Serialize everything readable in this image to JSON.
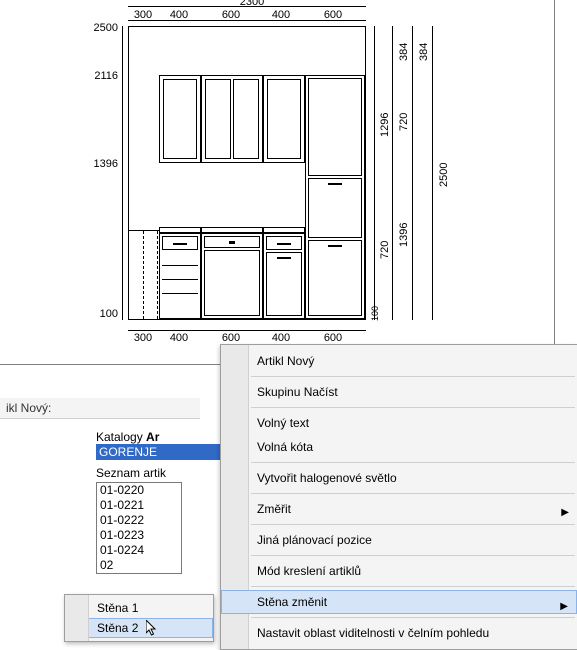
{
  "panel": {
    "title": "ikl Nový:"
  },
  "katalog": {
    "label_prefix": "Katalogy",
    "label_bold": "Ar",
    "selected": "GORENJE",
    "list_label": "Seznam artik",
    "items": [
      "01-0220",
      "01-0221",
      "01-0222",
      "01-0223",
      "01-0224",
      "02"
    ]
  },
  "context_menu": {
    "items": [
      {
        "label": "Artikl Nový",
        "sub": false
      },
      {
        "sep": true
      },
      {
        "label": "Skupinu Načíst",
        "sub": false
      },
      {
        "sep": true
      },
      {
        "label": "Volný text",
        "sub": false
      },
      {
        "label": "Volná kóta",
        "sub": false
      },
      {
        "sep": true
      },
      {
        "label": "Vytvořit halogenové světlo",
        "sub": false
      },
      {
        "sep": true
      },
      {
        "label": "Změřit",
        "sub": true
      },
      {
        "sep": true
      },
      {
        "label": "Jiná plánovací pozice",
        "sub": false
      },
      {
        "sep": true
      },
      {
        "label": "Mód kreslení artiklů",
        "sub": false
      },
      {
        "sep": true
      },
      {
        "label": "Stěna změnit",
        "sub": true,
        "highlight": true
      },
      {
        "sep": true
      },
      {
        "label": "Nastavit oblast viditelnosti v čelním pohledu",
        "sub": false
      }
    ]
  },
  "wall_submenu": {
    "items": [
      "Stěna 1",
      "Stěna 2"
    ],
    "highlight_index": 1
  },
  "dimensions": {
    "top_total": "2300",
    "top_segments": [
      "300",
      "400",
      "600",
      "400",
      "600"
    ],
    "bottom_segments": [
      "300",
      "400",
      "600",
      "400",
      "600"
    ],
    "left_top": "2500",
    "left_mid": "2116",
    "left_low": "1396",
    "left_base": "100",
    "right_outer": "2500",
    "right_inner_top": "384",
    "right_inner_top2": "384",
    "right_mid": "1296",
    "right_mid2": "720",
    "right_low1": "1396",
    "right_low2": "720",
    "right_tiny": "100"
  }
}
